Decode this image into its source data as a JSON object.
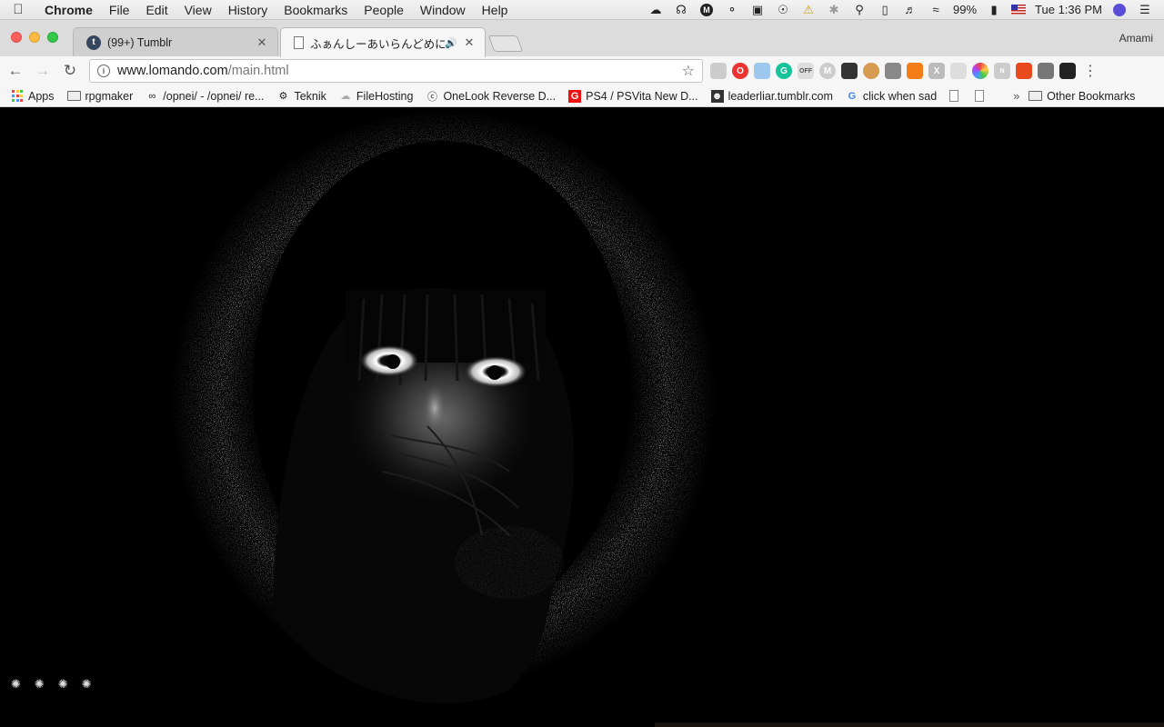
{
  "menubar": {
    "app_name": "Chrome",
    "items": [
      "File",
      "Edit",
      "View",
      "History",
      "Bookmarks",
      "People",
      "Window",
      "Help"
    ],
    "battery": "99%",
    "clock": "Tue 1:36 PM"
  },
  "tabs": [
    {
      "title": "(99+) Tumblr",
      "favicon": "t",
      "active": false
    },
    {
      "title": "ふぁんしーあいらんどめにゅー",
      "active": true
    }
  ],
  "profile_name": "Amami",
  "omnibox": {
    "host": "www.lomando.com",
    "path": "/main.html"
  },
  "bookmarks": [
    {
      "label": "Apps",
      "icon": "apps-grid-icon"
    },
    {
      "label": "rpgmaker",
      "icon": "folder-icon"
    },
    {
      "label": "/opnei/ - /opnei/ re...",
      "icon": "infinity-icon"
    },
    {
      "label": "Teknik",
      "icon": "robot-icon"
    },
    {
      "label": "FileHosting",
      "icon": "cloud-icon"
    },
    {
      "label": "OneLook Reverse D...",
      "icon": "onelook-icon"
    },
    {
      "label": "PS4 / PSVita New D...",
      "icon": "g-red-icon"
    },
    {
      "label": "leaderliar.tumblr.com",
      "icon": "avatar-icon"
    },
    {
      "label": "click when sad",
      "icon": "google-icon"
    }
  ],
  "other_bookmarks": "Other Bookmarks",
  "loader_glyphs": [
    "✺",
    "✺",
    "✺",
    "✺"
  ]
}
